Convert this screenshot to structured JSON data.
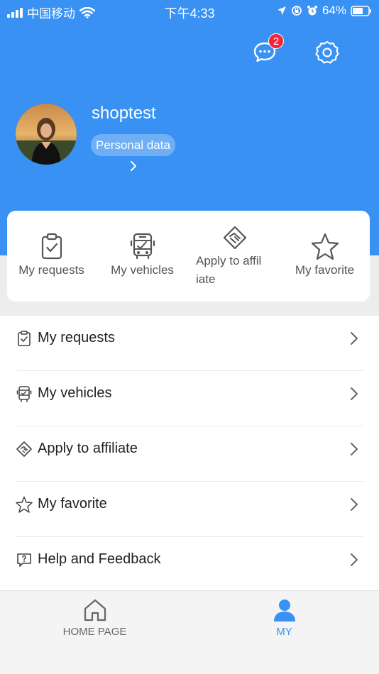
{
  "status_bar": {
    "carrier": "中国移动",
    "time": "下午4:33",
    "battery": "64%"
  },
  "header": {
    "message_badge": "2",
    "username": "shoptest",
    "personal_data_label": "Personal data"
  },
  "quick_actions": [
    {
      "label": "My requests",
      "icon": "clipboard-check-icon"
    },
    {
      "label": "My vehicles",
      "icon": "bus-icon"
    },
    {
      "label": "Apply to affil iate",
      "icon": "handshake-icon"
    },
    {
      "label": "My favorite",
      "icon": "star-icon"
    }
  ],
  "menu": [
    {
      "label": "My requests",
      "icon": "clipboard-check-icon"
    },
    {
      "label": "My vehicles",
      "icon": "bus-icon"
    },
    {
      "label": "Apply to affiliate",
      "icon": "handshake-icon"
    },
    {
      "label": "My favorite",
      "icon": "star-icon"
    },
    {
      "label": "Help and Feedback",
      "icon": "help-message-icon"
    }
  ],
  "tabbar": {
    "home_label": "HOME PAGE",
    "my_label": "MY",
    "active": "MY"
  },
  "colors": {
    "brand_blue": "#3891f3",
    "badge_red": "#f0273a",
    "inactive_tab": "#666666"
  }
}
